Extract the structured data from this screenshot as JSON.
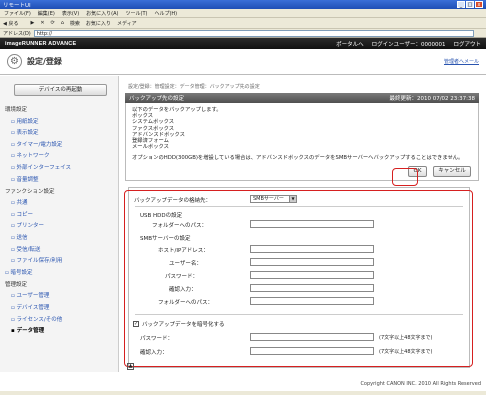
{
  "window": {
    "title": "リモートUI",
    "controls": [
      "_",
      "□",
      "x"
    ]
  },
  "menubar": [
    "ファイル(F)",
    "編集(E)",
    "表示(V)",
    "お気に入り(A)",
    "ツール(T)",
    "ヘルプ(H)"
  ],
  "toolbar": [
    "戻る",
    "進む",
    "検索",
    "お気に入り",
    "メディア"
  ],
  "address": {
    "label": "アドレス(D)",
    "value": "http://"
  },
  "header": {
    "brand": "imageRUNNER ADVANCE",
    "portal_link": "ポータルへ",
    "login_label": "ログインユーザー：0000001",
    "logout_link": "ログアウト"
  },
  "page": {
    "title": "設定/登録",
    "mail_link": "管理者へメール"
  },
  "sidebar": {
    "device_button": "デバイスの再起動",
    "groups": [
      {
        "label": "環境設定",
        "items": [
          "用紙設定",
          "表示設定",
          "タイマー/電力設定",
          "ネットワーク",
          "外部インターフェイス",
          "音量調整"
        ]
      },
      {
        "label": "ファンクション設定",
        "items": [
          "共通",
          "コピー",
          "プリンター",
          "送信",
          "受信/転送",
          "ファイル保存/利用"
        ]
      },
      {
        "label": "暗号設定",
        "items": []
      },
      {
        "label": "管理設定",
        "items": [
          "ユーザー管理",
          "デバイス管理",
          "ライセンス/その他",
          "データ管理"
        ]
      }
    ]
  },
  "main": {
    "breadcrumb": "設定/登録：管理設定：データ管理：バックアップ先の設定",
    "section_title": "バックアップ先の設定",
    "last_updated": "最終更新：2010 07/02 23:37:38",
    "info_lines": [
      "以下のデータをバックアップします。",
      "ボックス",
      "システムボックス",
      "ファクスボックス",
      "アドバンスドボックス",
      "登録済フォーム",
      "メールボックス"
    ],
    "note": "オプションのHDD(300GB)を増設している場合は、アドバンスドボックスのデータをSMBサーバーへバックアップすることはできません。",
    "ok_button": "OK",
    "cancel_button": "キャンセル"
  },
  "form": {
    "dest_label": "バックアップデータの格納先：",
    "dest_value": "SMBサーバー",
    "usb_heading": "USB HDDの設定",
    "usb_folder_label": "フォルダーへのパス：",
    "smb_heading": "SMBサーバーの設定",
    "smb_fields": [
      "ホスト/IPアドレス：",
      "ユーザー名：",
      "パスワード：",
      "確認入力：",
      "フォルダーへのパス："
    ],
    "encrypt_label": "バックアップデータを暗号化する",
    "encrypt_checked": true,
    "pw_label": "パスワード：",
    "pw_confirm_label": "確認入力：",
    "pw_hint": "(7文字以上48文字まで)"
  },
  "footer": {
    "copyright": "Copyright CANON INC. 2010 All Rights Reserved"
  },
  "accent": "#d62020"
}
